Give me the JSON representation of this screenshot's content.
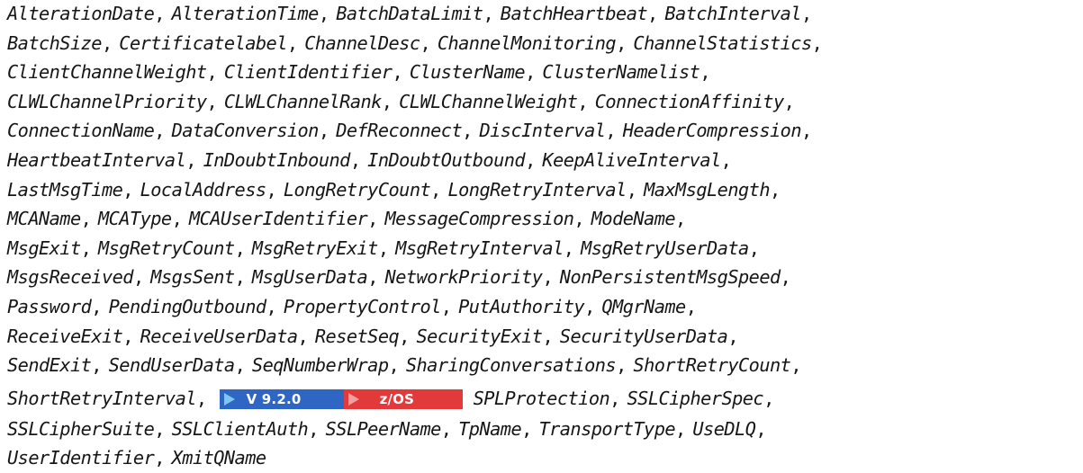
{
  "lines": [
    [
      "AlterationDate",
      "AlterationTime",
      "BatchDataLimit",
      "BatchHeartbeat",
      "BatchInterval"
    ],
    [
      "BatchSize",
      "Certificatelabel",
      "ChannelDesc",
      "ChannelMonitoring",
      "ChannelStatistics"
    ],
    [
      "ClientChannelWeight",
      "ClientIdentifier",
      "ClusterName",
      "ClusterNamelist"
    ],
    [
      "CLWLChannelPriority",
      "CLWLChannelRank",
      "CLWLChannelWeight",
      "ConnectionAffinity"
    ],
    [
      "ConnectionName",
      "DataConversion",
      "DefReconnect",
      "DiscInterval",
      "HeaderCompression"
    ],
    [
      "HeartbeatInterval",
      "InDoubtInbound",
      "InDoubtOutbound",
      "KeepAliveInterval"
    ],
    [
      "LastMsgTime",
      "LocalAddress",
      "LongRetryCount",
      "LongRetryInterval",
      "MaxMsgLength"
    ],
    [
      "MCAName",
      "MCAType",
      "MCAUserIdentifier",
      "MessageCompression",
      "ModeName"
    ],
    [
      "MsgExit",
      "MsgRetryCount",
      "MsgRetryExit",
      "MsgRetryInterval",
      "MsgRetryUserData"
    ],
    [
      "MsgsReceived",
      "MsgsSent",
      "MsgUserData",
      "NetworkPriority",
      "NonPersistentMsgSpeed"
    ],
    [
      "Password",
      "PendingOutbound",
      "PropertyControl",
      "PutAuthority",
      "QMgrName"
    ],
    [
      "ReceiveExit",
      "ReceiveUserData",
      "ResetSeq",
      "SecurityExit",
      "SecurityUserData"
    ],
    [
      "SendExit",
      "SendUserData",
      "SeqNumberWrap",
      "SharingConversations",
      "ShortRetryCount"
    ]
  ],
  "badge_line": {
    "before": "ShortRetryInterval",
    "badges": [
      {
        "label": "V 9.2.0",
        "color": "#2f66c4",
        "icon": "arrow-icon"
      },
      {
        "label": "z/OS",
        "color": "#e23a3a",
        "icon": "arrow-icon"
      }
    ],
    "after": [
      "SPLProtection",
      "SSLCipherSpec"
    ]
  },
  "tail_lines": [
    [
      "SSLCipherSuite",
      "SSLClientAuth",
      "SSLPeerName",
      "TpName",
      "TransportType",
      "UseDLQ"
    ],
    [
      "UserIdentifier",
      "XmitQName"
    ]
  ],
  "separator": ","
}
